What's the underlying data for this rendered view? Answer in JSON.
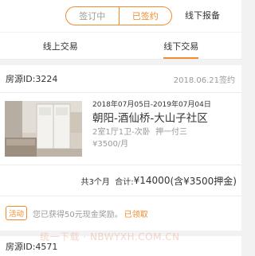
{
  "header": {
    "segments": [
      {
        "label": "签订中",
        "active": false
      },
      {
        "label": "已签约",
        "active": true
      }
    ],
    "offline_report": "线下报备"
  },
  "tabs": [
    {
      "label": "线上交易",
      "active": false
    },
    {
      "label": "线下交易",
      "active": true
    }
  ],
  "contract": {
    "room_id": "房源ID:3224",
    "signed_date": "2018.06.21签约",
    "period": "2018年07月05日-2019年07月04日",
    "title": "朝阳-酒仙桥-大山子社区",
    "layout": "2室1厅1卫-次卧",
    "payment": "押一付三",
    "price": "¥3500/月",
    "summary_prefix": "共3个月  合计:",
    "summary_total": "¥14000",
    "summary_suffix": "(含¥3500押金)",
    "promo_badge": "活动",
    "promo_text": "您已获得50元现金奖励。",
    "promo_link": "已领取"
  },
  "contract2": {
    "room_id": "房源ID:4571"
  },
  "watermark": "统一下载 · NBWYXH.COM.CN",
  "colors": {
    "accent": "#f08c2e",
    "muted": "#999999",
    "background": "#f2f2f2"
  }
}
